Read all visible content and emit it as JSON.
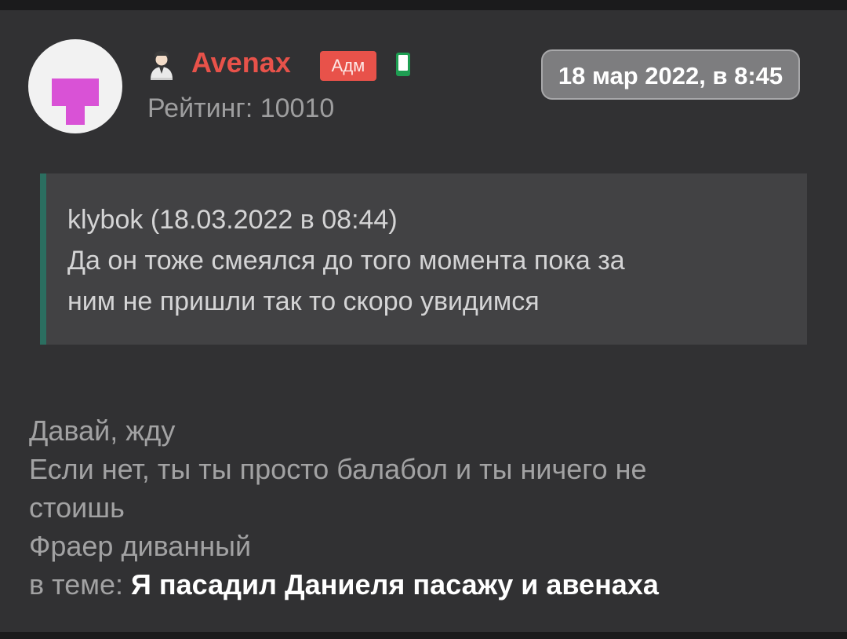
{
  "post": {
    "author": {
      "name": "Avenax",
      "role_badge": "Адм",
      "rating": "Рейтинг: 10010",
      "avatar_icon": "magenta-pixel-avatar",
      "user_icon": "user-person-icon",
      "status_icon": "online-phone-icon"
    },
    "date": "18 мар 2022, в 8:45",
    "quote": {
      "header": "klybok (18.03.2022 в 08:44)",
      "line1": "Да он тоже смеялся до того момента пока за",
      "line2": "ним не пришли так то скоро увидимся"
    },
    "message": {
      "line1": "Давай, жду",
      "line2": "Если нет, ты ты просто балабол и ты ничего не",
      "line3": "стоишь",
      "line4": "Фраер диванный"
    },
    "topic": {
      "prefix": "в теме: ",
      "title": "Я пасадил Даниеля пасажу и авенаха"
    }
  },
  "colors": {
    "background": "#313133",
    "accent_red": "#e8524a",
    "quote_border": "#2b6e60",
    "avatar_magenta": "#d952d6",
    "status_green": "#1e9e52"
  }
}
